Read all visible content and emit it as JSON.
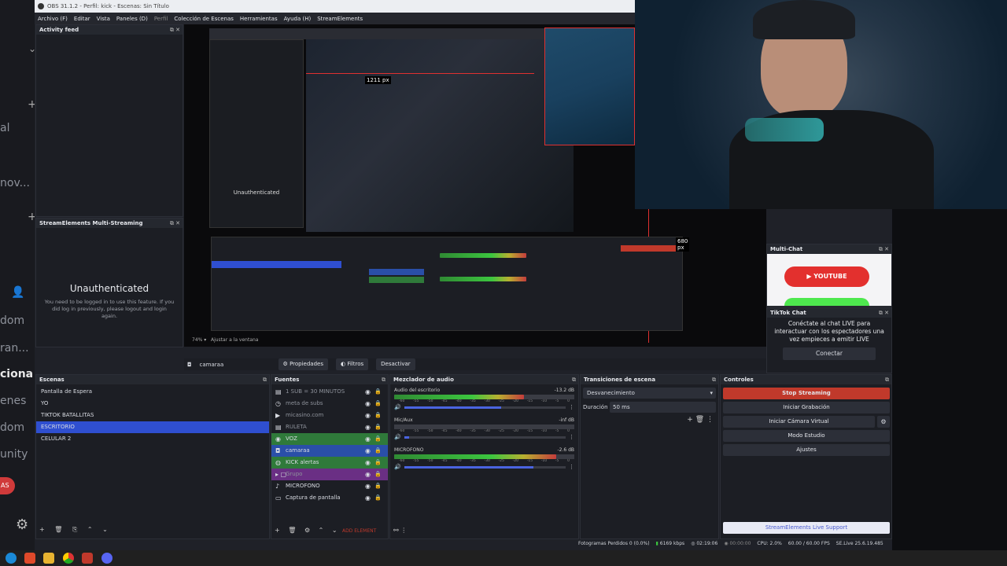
{
  "left_strip": {
    "texts": [
      "al",
      "nov...",
      "dom",
      "ran...",
      "ciona",
      "enes",
      "dom",
      "unity"
    ],
    "badge": "AS"
  },
  "window": {
    "title": "OBS 31.1.2 - Perfil: kick - Escenas: Sin Título"
  },
  "menu": [
    "Archivo (F)",
    "Editar",
    "Vista",
    "Paneles (D)",
    "Perfil",
    "Colección de Escenas",
    "Herramientas",
    "Ayuda (H)",
    "StreamElements"
  ],
  "activity_feed": {
    "title": "Activity feed"
  },
  "multistreaming": {
    "title": "StreamElements Multi-Streaming",
    "heading": "Unauthenticated",
    "body": "You need to be logged in to use this feature. If you did log in previously, please logout and login again."
  },
  "preview_toolbar": {
    "source": "camaraa",
    "props": "Propiedades",
    "filters": "Filtros",
    "deactivate": "Desactivar"
  },
  "preview_inner": {
    "dimension": "1211 px",
    "dimension2": "680 px",
    "zoom": "74%",
    "fit": "Ajustar a la ventana"
  },
  "multichat": {
    "title": "Multi-Chat",
    "youtube": "YOUTUBE"
  },
  "tiktok": {
    "title": "TikTok Chat",
    "message": "Conéctate al chat LIVE para interactuar con los espectadores una vez empieces a emitir LIVE",
    "button": "Conectar"
  },
  "scenes": {
    "title": "Escenas",
    "items": [
      "Pantalla de Espera",
      "YO",
      "TIKTOK BATALLITAS",
      "ESCRITORIO",
      "CELULAR 2"
    ],
    "selected": 3
  },
  "sources": {
    "title": "Fuentes",
    "items": [
      {
        "name": "1 SUB = 30 MINUTOS",
        "icon": "▤",
        "color": ""
      },
      {
        "name": "meta de subs",
        "icon": "◷",
        "color": ""
      },
      {
        "name": "micasino.com",
        "icon": "▶",
        "color": ""
      },
      {
        "name": "RULETA",
        "icon": "▤",
        "color": ""
      },
      {
        "name": "VOZ",
        "icon": "◉",
        "color": "#2f7a3a"
      },
      {
        "name": "camaraa",
        "icon": "◘",
        "color": "#2a4fa8"
      },
      {
        "name": "KICK alertas",
        "icon": "◍",
        "color": "#2f7a3a"
      },
      {
        "name": "Grupo",
        "icon": "▸ ▢",
        "color": "#6a2f84"
      },
      {
        "name": "MICROFONO",
        "icon": "♪",
        "color": ""
      },
      {
        "name": "Captura de pantalla",
        "icon": "▭",
        "color": ""
      }
    ],
    "add_element": "ADD ELEMENT"
  },
  "mixer": {
    "title": "Mezclador de audio",
    "tracks": [
      {
        "name": "Audio del escritorio",
        "db": "-13.2 dB"
      },
      {
        "name": "Mic/Aux",
        "db": "-inf dB"
      },
      {
        "name": "MICROFONO",
        "db": "-2.6 dB"
      }
    ],
    "scale": [
      "-60",
      "-55",
      "-50",
      "-45",
      "-40",
      "-35",
      "-30",
      "-25",
      "-20",
      "-15",
      "-10",
      "-5",
      "0"
    ]
  },
  "transitions": {
    "title": "Transiciones de escena",
    "selected": "Desvanecimiento",
    "duration_label": "Duración",
    "duration": "50 ms"
  },
  "controls": {
    "title": "Controles",
    "stop_stream": "Stop Streaming",
    "start_record": "Iniciar Grabación",
    "start_vcam": "Iniciar Cámara Virtual",
    "studio": "Modo Estudio",
    "settings": "Ajustes",
    "support": "StreamElements Live Support"
  },
  "status": {
    "dropped": "Fotogramas Perdidos 0 (0.0%)",
    "bitrate": "6169 kbps",
    "live_time": "02:19:06",
    "rec_time": "00:00:00",
    "cpu": "CPU: 2.0%",
    "fps": "60.00 / 60.00 FPS",
    "se": "SE.Live 25.6.19.485"
  },
  "colors": {
    "accent": "#2f4fd0",
    "stop": "#c0392b",
    "green": "#2f7a3a"
  }
}
